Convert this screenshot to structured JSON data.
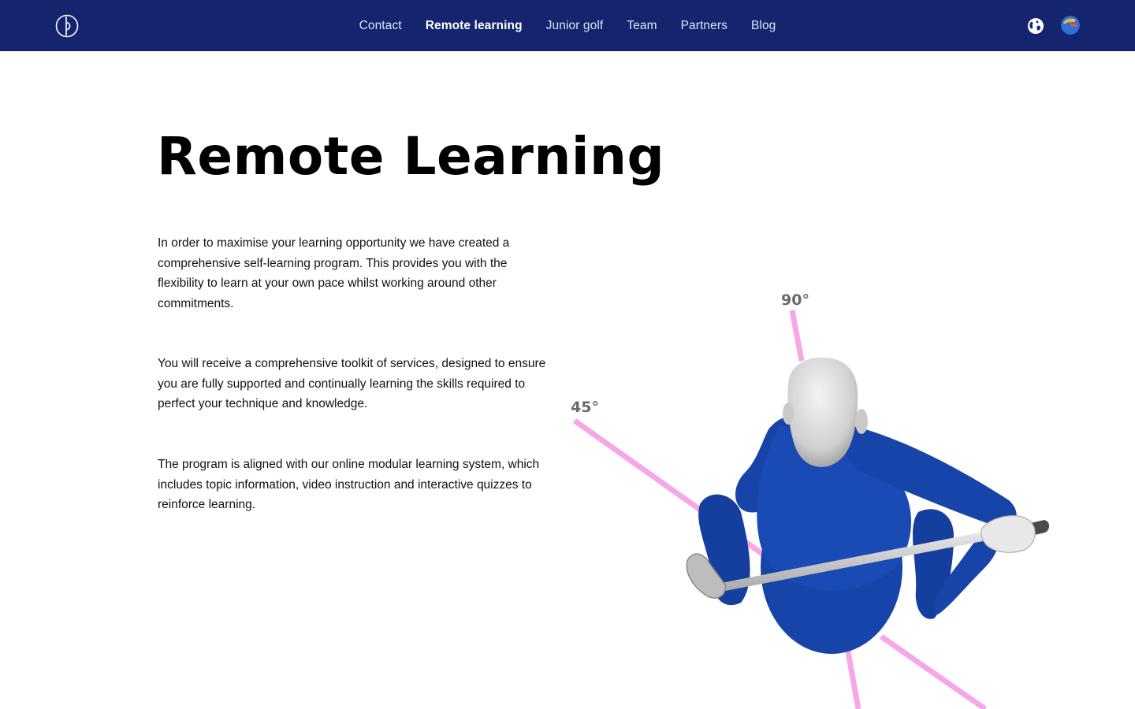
{
  "nav": {
    "links": [
      {
        "label": "Contact",
        "active": false
      },
      {
        "label": "Remote learning",
        "active": true
      },
      {
        "label": "Junior golf",
        "active": false
      },
      {
        "label": "Team",
        "active": false
      },
      {
        "label": "Partners",
        "active": false
      },
      {
        "label": "Blog",
        "active": false
      }
    ],
    "icons": {
      "logo": "logo-icon",
      "language": "globe-icon",
      "profile": "avatar"
    }
  },
  "main": {
    "title": "Remote Learning",
    "paragraphs": [
      "In order to maximise your learning opportunity we have created a comprehensive self-learning program. This provides you with the flexibility to learn at your own pace whilst working around other commitments.",
      "You will receive a comprehensive toolkit of services, designed to ensure you are fully supported and continually learning the skills required to perfect your technique and knowledge.",
      "The program is aligned with our online modular learning system, which includes topic information, video instruction and interactive quizzes to reinforce learning."
    ]
  },
  "illustration": {
    "angle_labels": [
      "90°",
      "45°"
    ]
  },
  "colors": {
    "nav_bg": "#14246e",
    "golfer_blue": "#1744a8",
    "angle_line_pink": "#f7a6e6"
  }
}
